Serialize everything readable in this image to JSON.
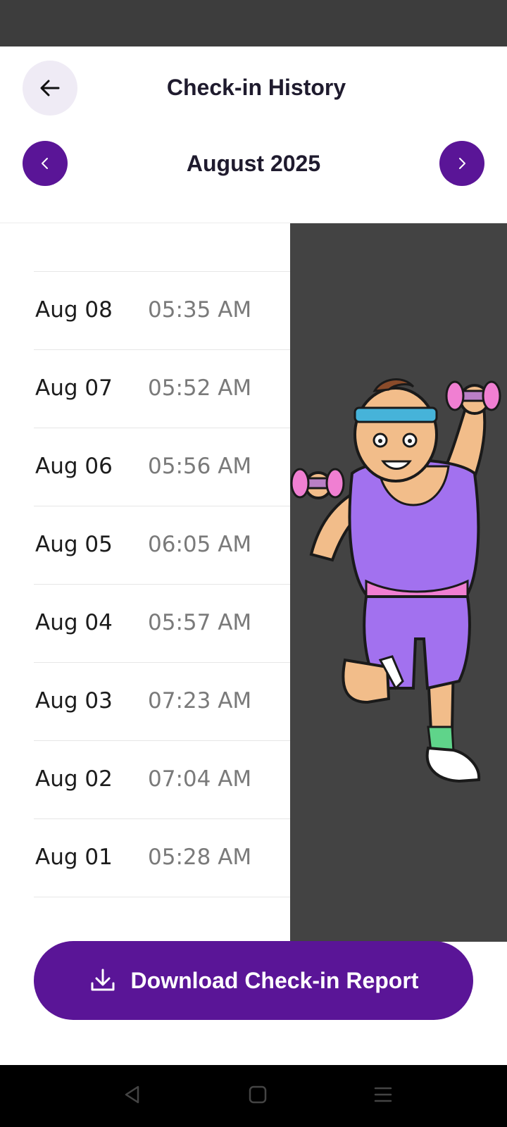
{
  "header": {
    "title": "Check-in History",
    "back_icon": "arrow-left-icon"
  },
  "month_nav": {
    "label": "August 2025",
    "prev_icon": "chevron-left-icon",
    "next_icon": "chevron-right-icon"
  },
  "checkins": [
    {
      "date": "Aug 08",
      "time": "05:35 AM"
    },
    {
      "date": "Aug 07",
      "time": "05:52 AM"
    },
    {
      "date": "Aug 06",
      "time": "05:56 AM"
    },
    {
      "date": "Aug 05",
      "time": "06:05 AM"
    },
    {
      "date": "Aug 04",
      "time": "05:57 AM"
    },
    {
      "date": "Aug 03",
      "time": "07:23 AM"
    },
    {
      "date": "Aug 02",
      "time": "07:04 AM"
    },
    {
      "date": "Aug 01",
      "time": "05:28 AM"
    }
  ],
  "illustration": "workout-mascot-illustration",
  "download": {
    "label": "Download Check-in Report",
    "icon": "download-icon"
  },
  "colors": {
    "accent": "#5a1597",
    "back_button_bg": "#efebf5",
    "illustration_bg": "#434343"
  },
  "system_nav": {
    "back_icon": "nav-back-icon",
    "home_icon": "nav-home-icon",
    "menu_icon": "nav-menu-icon"
  }
}
